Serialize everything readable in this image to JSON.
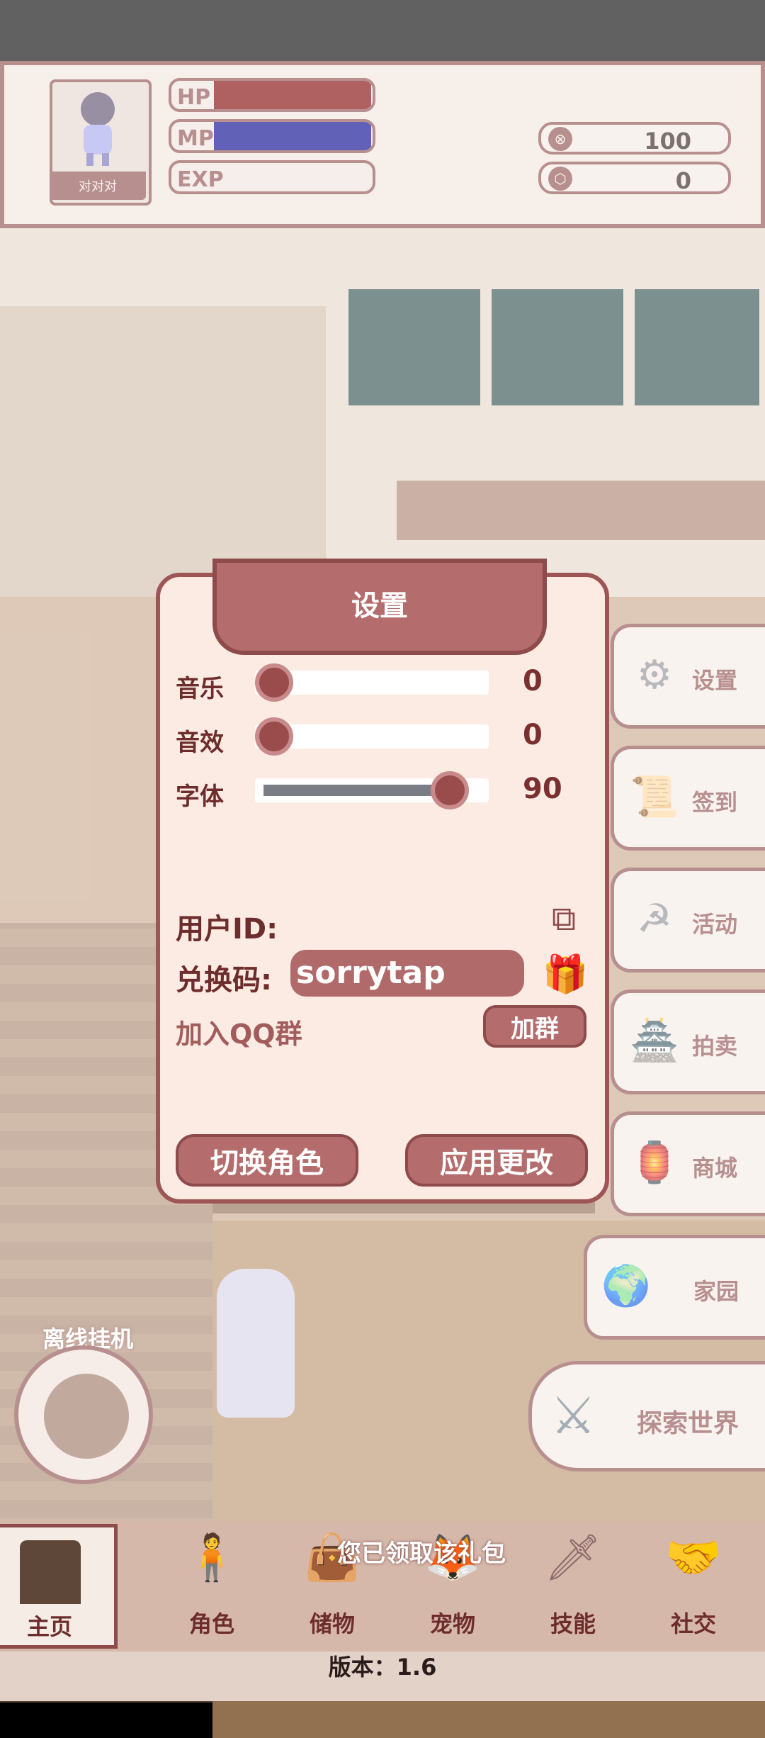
{
  "player": {
    "name": "对对对",
    "stats": {
      "hp_label": "HP",
      "mp_label": "MP",
      "exp_label": "EXP",
      "hp_fill": 1.0,
      "mp_fill": 1.0,
      "exp_fill": 0.0
    },
    "currencies": [
      {
        "icon": "coin-icon",
        "value": "100"
      },
      {
        "icon": "gem-icon",
        "value": "0"
      }
    ]
  },
  "side_menu": [
    {
      "label": "设置",
      "icon": "gear-icon"
    },
    {
      "label": "签到",
      "icon": "scroll-icon"
    },
    {
      "label": "活动",
      "icon": "event-icon"
    },
    {
      "label": "拍卖",
      "icon": "auction-icon"
    },
    {
      "label": "商城",
      "icon": "shop-icon"
    },
    {
      "label": "家园",
      "icon": "homeland-icon"
    }
  ],
  "explore": {
    "label": "探索世界",
    "icon": "swords-icon"
  },
  "offline": {
    "label": "离线挂机",
    "icon": "bear-icon"
  },
  "dialog": {
    "title": "设置",
    "sliders": [
      {
        "label": "音乐",
        "value": "0",
        "level": 0
      },
      {
        "label": "音效",
        "value": "0",
        "level": 0
      },
      {
        "label": "字体",
        "value": "90",
        "level": 0.9
      }
    ],
    "user_id_label": "用户ID:",
    "redeem_label": "兑换码:",
    "redeem_code": "sorrytap",
    "qq_group_label": "加入QQ群",
    "join_button": "加群",
    "switch_role_button": "切换角色",
    "apply_button": "应用更改"
  },
  "bottom_nav": [
    {
      "label": "主页",
      "icon": "home-gate-icon"
    },
    {
      "label": "角色",
      "icon": "character-icon"
    },
    {
      "label": "储物",
      "icon": "storage-icon"
    },
    {
      "label": "宠物",
      "icon": "pet-icon"
    },
    {
      "label": "技能",
      "icon": "skill-icon"
    },
    {
      "label": "社交",
      "icon": "social-icon"
    }
  ],
  "toast": "您已领取该礼包",
  "version": "版本：1.6",
  "colors": {
    "primary": "#8d4b4b",
    "accent": "#b56c6d",
    "panel": "#fcebe2",
    "hp": "#7f0000",
    "mp": "#00008c"
  }
}
